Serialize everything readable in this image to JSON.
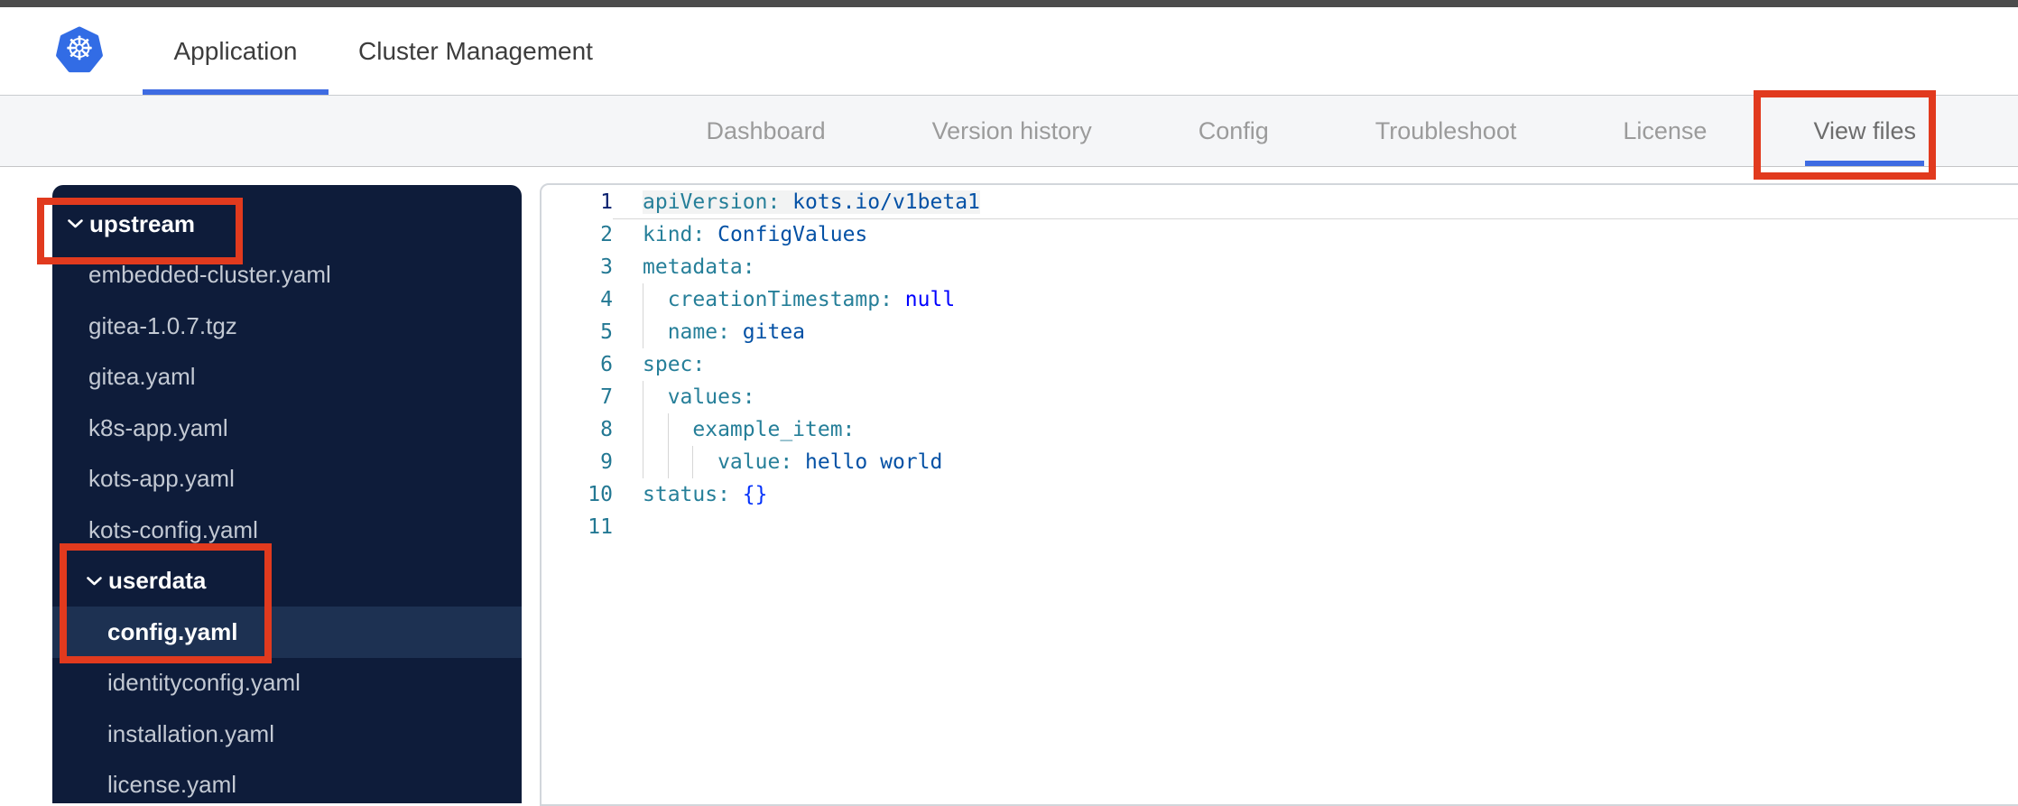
{
  "topnav": {
    "tabs": [
      {
        "label": "Application",
        "active": true
      },
      {
        "label": "Cluster Management",
        "active": false
      }
    ]
  },
  "subnav": {
    "tabs": [
      "Dashboard",
      "Version history",
      "Config",
      "Troubleshoot",
      "License",
      "View files"
    ],
    "active": "View files"
  },
  "file_tree": {
    "items": [
      {
        "type": "folder",
        "label": "upstream",
        "level": 1,
        "expanded": true
      },
      {
        "type": "file",
        "label": "embedded-cluster.yaml",
        "level": 1
      },
      {
        "type": "file",
        "label": "gitea-1.0.7.tgz",
        "level": 1
      },
      {
        "type": "file",
        "label": "gitea.yaml",
        "level": 1
      },
      {
        "type": "file",
        "label": "k8s-app.yaml",
        "level": 1
      },
      {
        "type": "file",
        "label": "kots-app.yaml",
        "level": 1
      },
      {
        "type": "file",
        "label": "kots-config.yaml",
        "level": 1
      },
      {
        "type": "folder",
        "label": "userdata",
        "level": 2,
        "expanded": true
      },
      {
        "type": "file",
        "label": "config.yaml",
        "level": 2,
        "selected": true
      },
      {
        "type": "file",
        "label": "identityconfig.yaml",
        "level": 2
      },
      {
        "type": "file",
        "label": "installation.yaml",
        "level": 2
      },
      {
        "type": "file",
        "label": "license.yaml",
        "level": 2
      }
    ]
  },
  "editor": {
    "language": "yaml",
    "lines": [
      {
        "n": "1",
        "guides": 0,
        "current": true,
        "segments": [
          {
            "t": "apiVersion:",
            "c": "key"
          },
          {
            "t": " kots.io/v1beta1",
            "c": "val"
          }
        ]
      },
      {
        "n": "2",
        "guides": 0,
        "segments": [
          {
            "t": "kind:",
            "c": "key"
          },
          {
            "t": " ConfigValues",
            "c": "val"
          }
        ]
      },
      {
        "n": "3",
        "guides": 0,
        "segments": [
          {
            "t": "metadata:",
            "c": "key"
          }
        ]
      },
      {
        "n": "4",
        "guides": 1,
        "segments": [
          {
            "t": "  creationTimestamp:",
            "c": "key"
          },
          {
            "t": " null",
            "c": "kw"
          }
        ]
      },
      {
        "n": "5",
        "guides": 1,
        "segments": [
          {
            "t": "  name:",
            "c": "key"
          },
          {
            "t": " gitea",
            "c": "val"
          }
        ]
      },
      {
        "n": "6",
        "guides": 0,
        "segments": [
          {
            "t": "spec:",
            "c": "key"
          }
        ]
      },
      {
        "n": "7",
        "guides": 1,
        "segments": [
          {
            "t": "  values:",
            "c": "key"
          }
        ]
      },
      {
        "n": "8",
        "guides": 2,
        "segments": [
          {
            "t": "    example_item:",
            "c": "key"
          }
        ]
      },
      {
        "n": "9",
        "guides": 3,
        "segments": [
          {
            "t": "      value:",
            "c": "key"
          },
          {
            "t": " hello world",
            "c": "val"
          }
        ]
      },
      {
        "n": "10",
        "guides": 0,
        "segments": [
          {
            "t": "status:",
            "c": "key"
          },
          {
            "t": " {}",
            "c": "brace"
          }
        ]
      },
      {
        "n": "11",
        "guides": 0,
        "segments": []
      }
    ]
  },
  "annotations": {
    "color": "#e13a1e",
    "boxes": [
      "view-files-tab",
      "upstream-folder",
      "userdata-config-yaml"
    ]
  },
  "icons": {
    "logo": "kubernetes-helm-icon",
    "folder_toggle": "chevron-down-icon"
  },
  "colors": {
    "kubernetes_blue": "#326CE5",
    "active_underline": "#3e6be2",
    "sidebar_bg": "#0e1c3a",
    "sidebar_selected_bg": "#1d3152",
    "sidebar_file_text": "#c3c9d3",
    "subnav_bg": "#f5f6f8",
    "subnav_inactive_text": "#9b9b9b",
    "subnav_active_text": "#6d6d6d",
    "code_key": "#267f99",
    "code_value": "#0451a5",
    "code_keyword": "#0000ff",
    "code_bracket": "#0431fa",
    "line_number": "#237893",
    "active_line_number": "#0b216f"
  }
}
